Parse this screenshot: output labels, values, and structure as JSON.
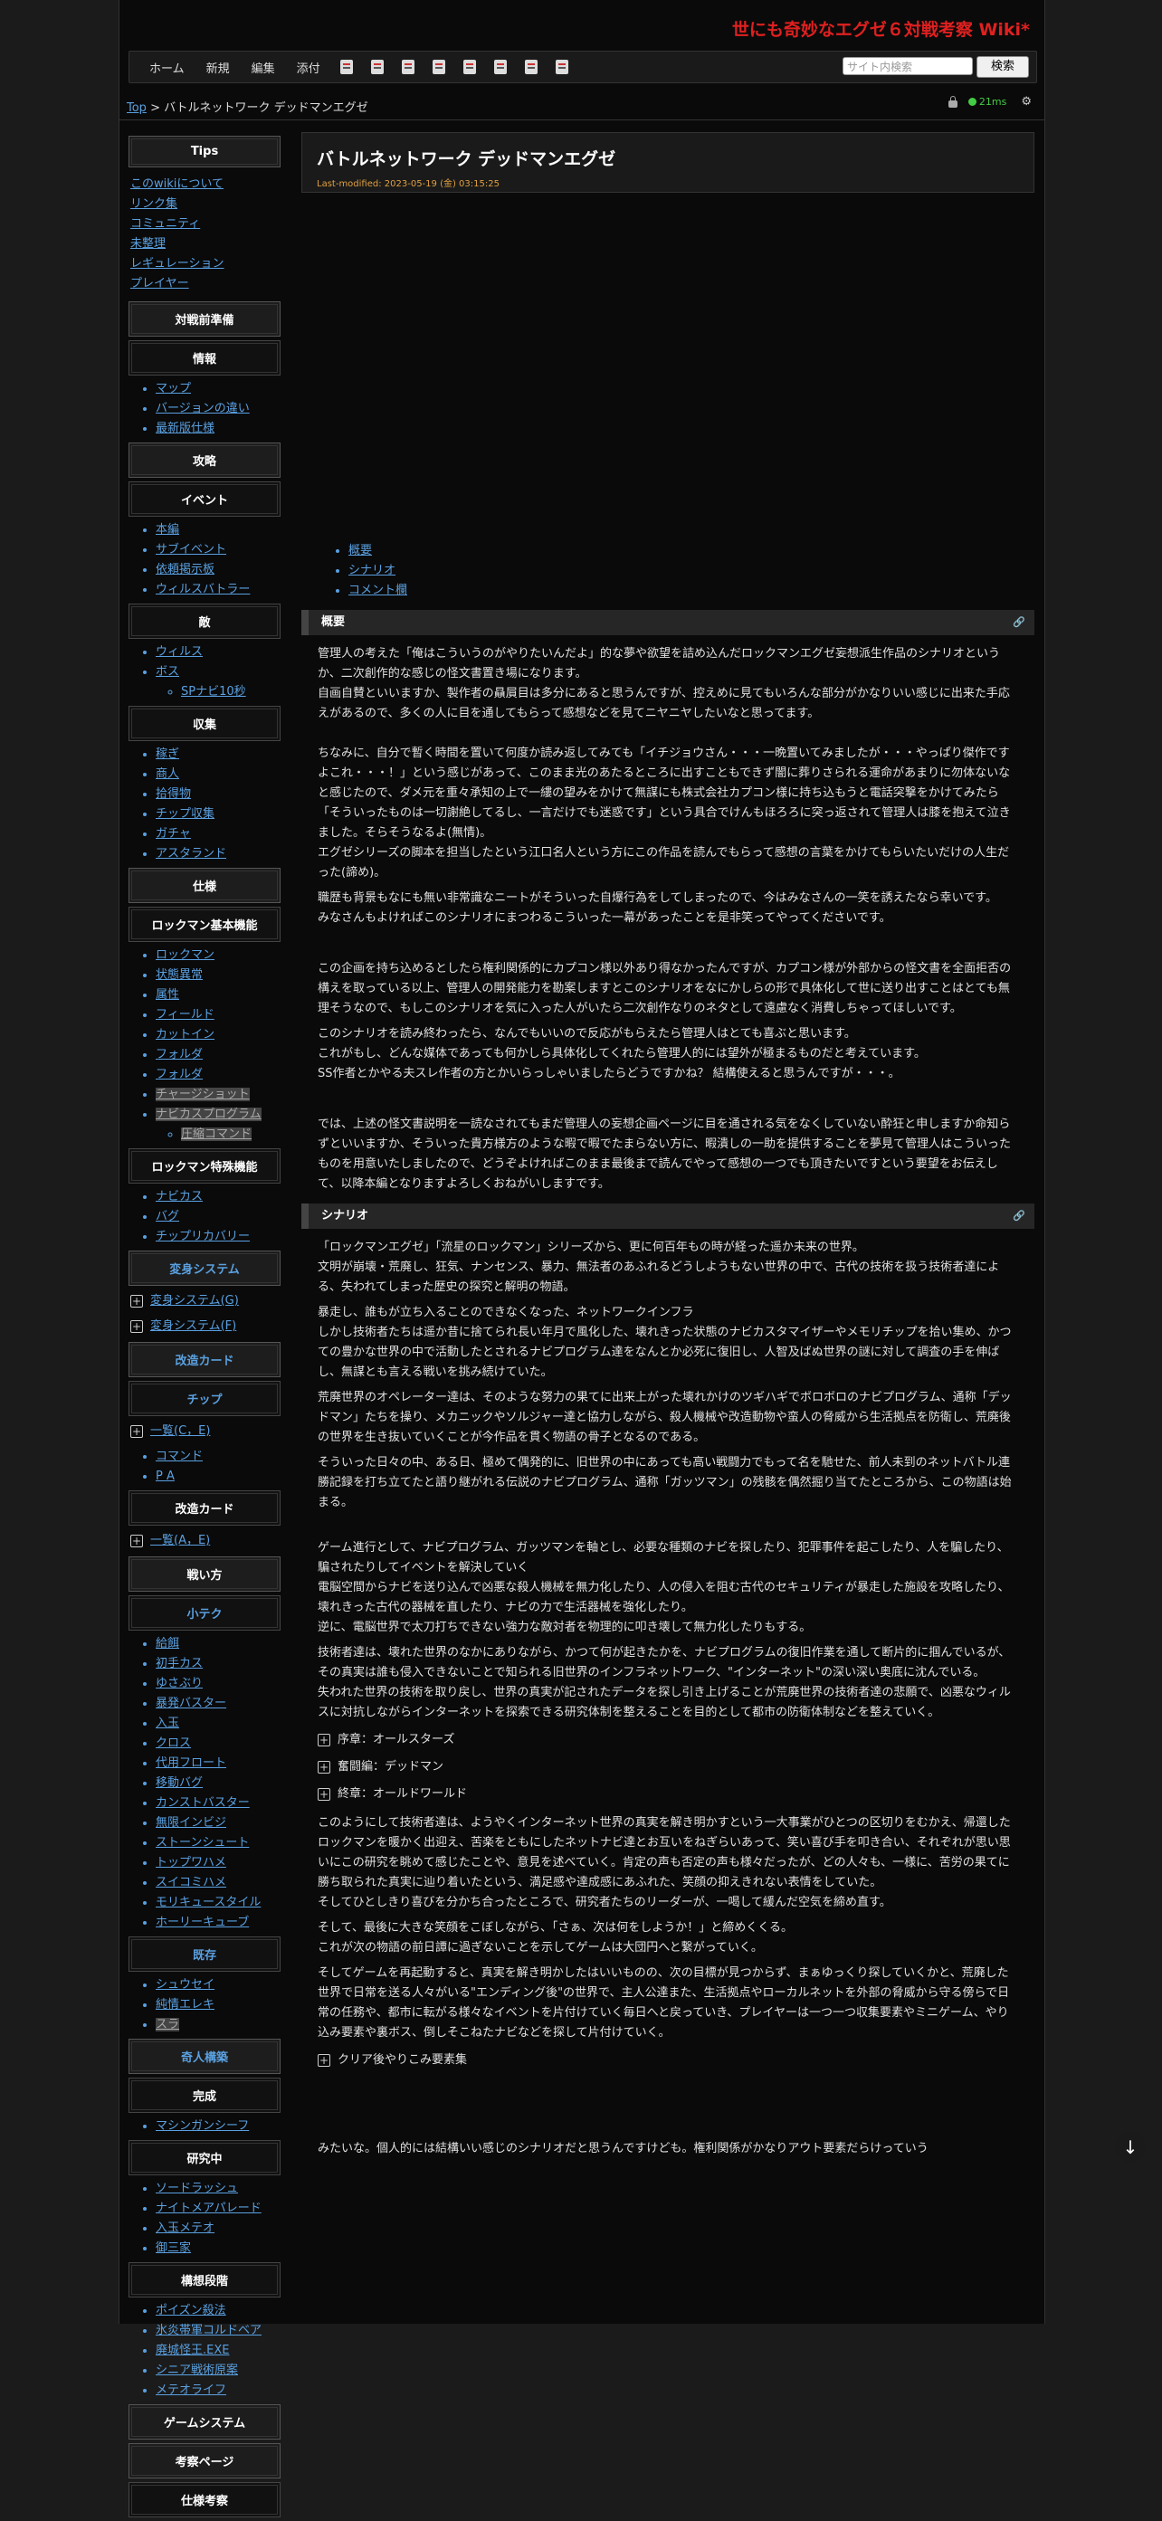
{
  "site_title": "世にも奇妙なエグゼ６対戦考察 Wiki*",
  "toolbar": {
    "nav": [
      "ホーム",
      "新規",
      "編集",
      "添付"
    ],
    "icons": [
      "edit-icon",
      "diff-icon",
      "pdf-icon",
      "backup-icon",
      "folder-icon",
      "copy-icon",
      "rename-icon",
      "list-icon"
    ],
    "search_placeholder": "サイト内検索",
    "search_button": "検索"
  },
  "breadcrumb": {
    "top": "Top",
    "sep": " > ",
    "current": "バトルネットワーク デッドマンエグゼ"
  },
  "status": {
    "ms": "21ms"
  },
  "page": {
    "title": "バトルネットワーク デッドマンエグゼ",
    "last_modified": "Last-modified: 2023-05-19 (金) 03:15:25"
  },
  "toc": [
    "概要",
    "シナリオ",
    "コメント欄"
  ],
  "sidebar": {
    "tips": "Tips",
    "tips_links": [
      "このwikiについて",
      "リンク集",
      "コミュニティ",
      "未整理",
      "レギュレーション",
      "プレイヤー"
    ],
    "pre": "対戦前準備",
    "info": "情報",
    "info_items": [
      "マップ",
      "バージョンの違い",
      "最新版仕様"
    ],
    "attack": "攻略",
    "event": "イベント",
    "event_items": [
      "本編",
      "サブイベント",
      "依頼掲示板",
      "ウィルスバトラー"
    ],
    "enemy": "敵",
    "enemy_items": [
      "ウィルス",
      "ボス"
    ],
    "enemy_sub": "SPナビ10秒",
    "collect": "収集",
    "collect_items": [
      "稼ぎ",
      "商人",
      "拾得物",
      "チップ収集",
      "ガチャ",
      "アスタランド"
    ],
    "spec": "仕様",
    "rm_basic": "ロックマン基本機能",
    "rm_basic_items": [
      "ロックマン",
      "状態異常",
      "属性",
      "フィールド",
      "カットイン",
      "フォルダ",
      "フォルダ",
      "チャージショット",
      "ナビカスプログラム"
    ],
    "rm_basic_sub": "圧縮コマンド",
    "rm_special": "ロックマン特殊機能",
    "rm_special_items": [
      "ナビカス",
      "バグ",
      "チップリカバリー"
    ],
    "henshin": "変身システム",
    "henshin_g": "変身システム(G)",
    "henshin_f": "変身システム(F)",
    "kaizou": "改造カード",
    "chip": "チップ",
    "chip_list": "一覧(C，E)",
    "chip_items": [
      "コマンド",
      "P A"
    ],
    "kaizou2": "改造カード",
    "kaizou_list": "一覧(A，E)",
    "tactics": "戦い方",
    "technique": "小テク",
    "technique_items": [
      "給餌",
      "初手カス",
      "ゆさぶり",
      "暴発バスター",
      "入玉",
      "クロス",
      "代用フロート",
      "移動バグ",
      "カンストバスター",
      "無限インビジ",
      "ストーンシュート",
      "トップワハメ",
      "スイコミハメ",
      "モリキュースタイル",
      "ホーリーキューブ"
    ],
    "existing": "既存",
    "existing_items": [
      "シュウセイ",
      "純情エレキ",
      "スラ"
    ],
    "odd": "奇人構築",
    "done": "完成",
    "done_items": [
      "マシンガンシーフ"
    ],
    "research": "研究中",
    "research_items": [
      "ソードラッシュ",
      "ナイトメアパレード",
      "入玉メテオ",
      "御三家"
    ],
    "concept": "構想段階",
    "concept_items": [
      "ポイズン殺法",
      "氷炎帯軍コルドベア",
      "廃城怪王.EXE",
      "シニア戦術原案",
      "メテオライフ"
    ],
    "game_system": "ゲームシステム",
    "analysis": "考察ページ",
    "spec_analysis": "仕様考察"
  },
  "sections": {
    "overview": {
      "heading": "概要",
      "paragraphs": [
        "管理人の考えた「俺はこういうのがやりたいんだよ」的な夢や欲望を詰め込んだロックマンエグゼ妄想派生作品のシナリオというか、二次創作的な感じの怪文書置き場になります。\n自画自賛といいますか、製作者の贔屓目は多分にあると思うんですが、控えめに見てもいろんな部分がかなりいい感じに出来た手応えがあるので、多くの人に目を通してもらって感想などを見てニヤニヤしたいなと思ってます。",
        "ちなみに、自分で暫く時間を置いて何度か読み返してみても「イチジョウさん・・・一晩置いてみましたが・・・やっぱり傑作ですよこれ・・・！」という感じがあって、このまま光のあたるところに出すこともできず闇に葬りさられる運命があまりに勿体ないなと感じたので、ダメ元を重々承知の上で一縷の望みをかけて無謀にも株式会社カプコン様に持ち込もうと電話突撃をかけてみたら「そういったものは一切謝絶してるし、一言だけでも迷惑です」という具合でけんもほろろに突っ返されて管理人は膝を抱えて泣きました。そらそうなるよ(無情)。\nエグゼシリーズの脚本を担当したという江口名人という方にこの作品を読んでもらって感想の言葉をかけてもらいたいだけの人生だった(諦め)。",
        "職歴も背景もなにも無い非常識なニートがそういった自爆行為をしてしまったので、今はみなさんの一笑を誘えたなら幸いです。\nみなさんもよければこのシナリオにまつわるこういった一幕があったことを是非笑ってやってくださいです。",
        "この企画を持ち込めるとしたら権利関係的にカプコン様以外あり得なかったんですが、カプコン様が外部からの怪文書を全面拒否の構えを取っている以上、管理人の開発能力を勘案しますとこのシナリオをなにかしらの形で具体化して世に送り出すことはとても無理そうなので、もしこのシナリオを気に入った人がいたら二次創作なりのネタとして遠慮なく消費しちゃってほしいです。",
        "このシナリオを読み終わったら、なんでもいいので反応がもらえたら管理人はとても喜ぶと思います。\nこれがもし、どんな媒体であっても何かしら具体化してくれたら管理人的には望外が極まるものだと考えています。\nSS作者とかやる夫スレ作者の方とかいらっしゃいましたらどうですかね？ 結構使えると思うんですが・・・。",
        "では、上述の怪文書説明を一読なされてもまだ管理人の妄想企画ページに目を通される気をなくしていない酔狂と申しますか命知らずといいますか、そういった貴方様方のような暇で暇でたまらない方に、暇潰しの一助を提供することを夢見て管理人はこういったものを用意いたしましたので、どうぞよければこのまま最後まで読んでやって感想の一つでも頂きたいですという要望をお伝えして、以降本編となりますよろしくおねがいしますです。"
      ]
    },
    "scenario": {
      "heading": "シナリオ",
      "paragraphs": [
        "「ロックマンエグゼ」「流星のロックマン」シリーズから、更に何百年もの時が経った遥か未来の世界。\n文明が崩壊・荒廃し、狂気、ナンセンス、暴力、無法者のあふれるどうしようもない世界の中で、古代の技術を扱う技術者達による、失われてしまった歴史の探究と解明の物語。",
        "暴走し、誰もが立ち入ることのできなくなった、ネットワークインフラ\nしかし技術者たちは遥か昔に捨てられ長い年月で風化した、壊れきった状態のナビカスタマイザーやメモリチップを拾い集め、かつての豊かな世界の中で活動したとされるナビプログラム達をなんとか必死に復旧し、人智及ばぬ世界の謎に対して調査の手を伸ばし、無謀とも言える戦いを挑み続けていた。",
        "荒廃世界のオペレーター達は、そのような努力の果てに出来上がった壊れかけのツギハギでボロボロのナビプログラム、通称「デッドマン」たちを操り、メカニックやソルジャー達と協力しながら、殺人機械や改造動物や蛮人の脅威から生活拠点を防衛し、荒廃後の世界を生き抜いていくことが今作品を貫く物語の骨子となるのである。",
        "そういった日々の中、ある日、極めて偶発的に、旧世界の中にあっても高い戦闘力でもって名を馳せた、前人未到のネットバトル連勝記録を打ち立てたと語り継がれる伝説のナビプログラム、通称「ガッツマン」の残骸を偶然掘り当てたところから、この物語は始まる。",
        "ゲーム進行として、ナビプログラム、ガッツマンを軸とし、必要な種類のナビを探したり、犯罪事件を起こしたり、人を騙したり、騙されたりしてイベントを解決していく\n電脳空間からナビを送り込んで凶悪な殺人機械を無力化したり、人の侵入を阻む古代のセキュリティが暴走した施設を攻略したり、壊れきった古代の器械を直したり、ナビの力で生活器械を強化したり。\n逆に、電脳世界で太刀打ちできない強力な敵対者を物理的に叩き壊して無力化したりもする。",
        "技術者達は、壊れた世界のなかにありながら、かつて何が起きたかを、ナビプログラムの復旧作業を通して断片的に掴んでいるが、その真実は誰も侵入できないことで知られる旧世界のインフラネットワーク、\"インターネット\"の深い深い奥底に沈んでいる。\n失われた世界の技術を取り戻し、世界の真実が記されたデータを探し引き上げることが荒廃世界の技術者達の悲願で、凶悪なウィルスに対抗しながらインターネットを探索できる研究体制を整えることを目的として都市の防衛体制などを整えていく。"
      ],
      "folds": [
        "序章：オールスターズ",
        "奮闘編：デッドマン",
        "終章：オールドワールド"
      ],
      "paragraphs2": [
        "このようにして技術者達は、ようやくインターネット世界の真実を解き明かすという一大事業がひとつの区切りをむかえ、帰還したロックマンを暖かく出迎え、苦楽をともにしたネットナビ達とお互いをねぎらいあって、笑い喜び手を叩き合い、それぞれが思い思いにこの研究を眺めて感じたことや、意見を述べていく。肯定の声も否定の声も様々だったが、どの人々も、一様に、苦労の果てに勝ち取られた真実に辿り着いたという、満足感や達成感にあふれた、笑顔の抑えきれない表情をしていた。\nそしてひとしきり喜びを分かち合ったところで、研究者たちのリーダーが、一喝して緩んだ空気を締め直す。",
        "そして、最後に大きな笑顔をこぼしながら、「さぁ、次は何をしようか！」と締めくくる。\nこれが次の物語の前日譚に過ぎないことを示してゲームは大団円へと繋がっていく。",
        "そしてゲームを再起動すると、真実を解き明かしたはいいものの、次の目標が見つからず、まぁゆっくり探していくかと、荒廃した世界で日常を送る人々がいる\"エンディング後\"の世界で、主人公達また、生活拠点やローカルネットを外部の脅威から守る傍らで日常の任務や、都市に転がる様々なイベントを片付けていく毎日へと戻っていき、プレイヤーは一つ一つ収集要素やミニゲーム、やり込み要素や裏ボス、倒しそこねたナビなどを探して片付けていく。"
      ],
      "fold_last": "クリア後やりこみ要素集"
    },
    "tail": "みたいな。個人的には結構いい感じのシナリオだと思うんですけども。権利関係がかなりアウト要素だらけっていう"
  },
  "colors": {
    "accent_red": "#e02020",
    "link": "#5aa0e0",
    "modified": "#e0a040",
    "ms_green": "#44cc44"
  }
}
